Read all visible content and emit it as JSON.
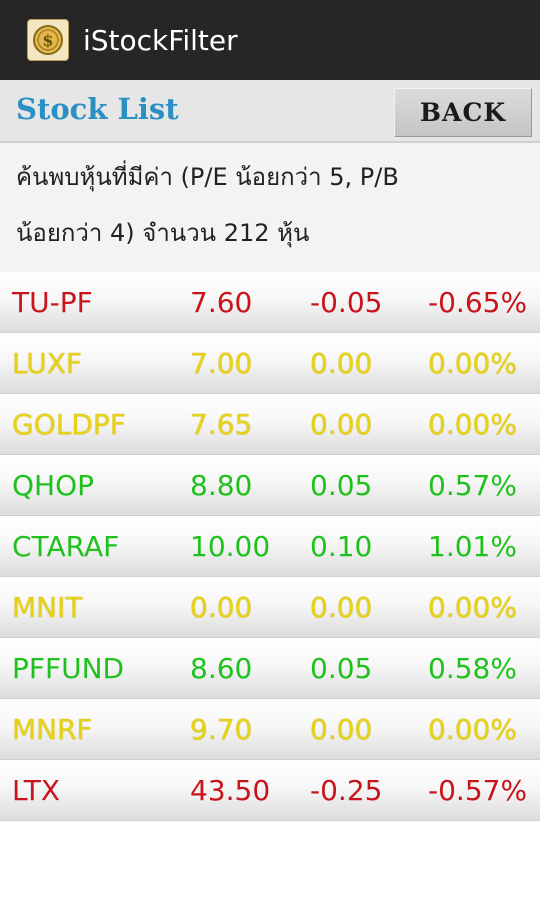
{
  "app": {
    "title": "iStockFilter",
    "icon": "coin-icon"
  },
  "header": {
    "title": "Stock List",
    "back_label": "BACK"
  },
  "description": {
    "line1": "ค้นพบหุ้นที่มีค่า (P/E น้อยกว่า 5, P/B",
    "line2": "น้อยกว่า 4) จำนวน 212 หุ้น"
  },
  "colors": {
    "down": "#c8141a",
    "unchanged": "#e8d215",
    "up": "#1fc21c",
    "header_title": "#2a8fc2"
  },
  "stocks": [
    {
      "symbol": "TU-PF",
      "price": "7.60",
      "change": "-0.05",
      "percent": "-0.65%",
      "trend": "down"
    },
    {
      "symbol": "LUXF",
      "price": "7.00",
      "change": "0.00",
      "percent": "0.00%",
      "trend": "unchanged"
    },
    {
      "symbol": "GOLDPF",
      "price": "7.65",
      "change": "0.00",
      "percent": "0.00%",
      "trend": "unchanged"
    },
    {
      "symbol": "QHOP",
      "price": "8.80",
      "change": "0.05",
      "percent": "0.57%",
      "trend": "up"
    },
    {
      "symbol": "CTARAF",
      "price": "10.00",
      "change": "0.10",
      "percent": "1.01%",
      "trend": "up"
    },
    {
      "symbol": "MNIT",
      "price": "0.00",
      "change": "0.00",
      "percent": "0.00%",
      "trend": "unchanged"
    },
    {
      "symbol": "PFFUND",
      "price": "8.60",
      "change": "0.05",
      "percent": "0.58%",
      "trend": "up"
    },
    {
      "symbol": "MNRF",
      "price": "9.70",
      "change": "0.00",
      "percent": "0.00%",
      "trend": "unchanged"
    },
    {
      "symbol": "LTX",
      "price": "43.50",
      "change": "-0.25",
      "percent": "-0.57%",
      "trend": "down"
    }
  ]
}
